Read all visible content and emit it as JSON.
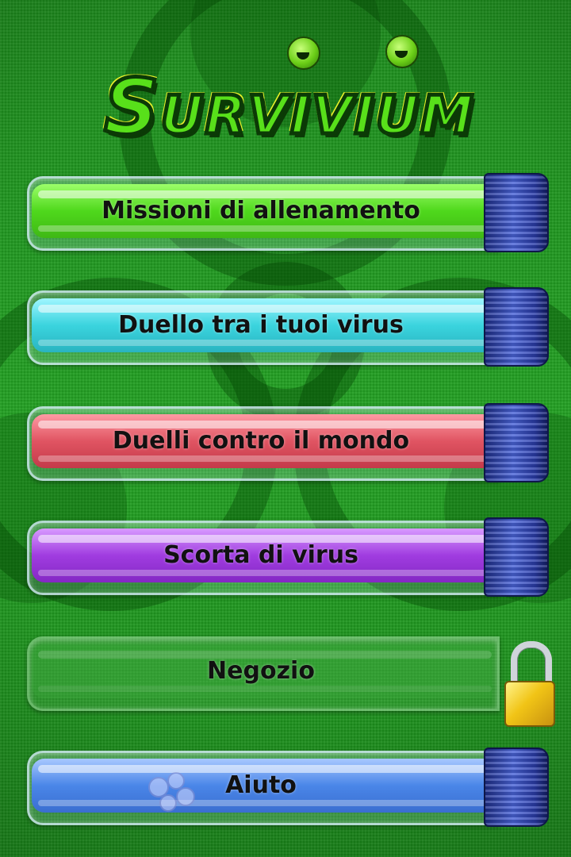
{
  "game": {
    "title": "Survivium"
  },
  "menu": {
    "items": [
      {
        "id": "training",
        "label": "Missioni di allenamento",
        "color": "#5be82a",
        "locked": false
      },
      {
        "id": "duel-own",
        "label": "Duello tra i tuoi virus",
        "color": "#40d8e0",
        "locked": false
      },
      {
        "id": "duel-world",
        "label": "Duelli contro il mondo",
        "color": "#e05a68",
        "locked": false
      },
      {
        "id": "virus-stock",
        "label": "Scorta di virus",
        "color": "#a43ee0",
        "locked": false
      },
      {
        "id": "shop",
        "label": "Negozio",
        "color": "#3aa83a",
        "locked": true
      },
      {
        "id": "help",
        "label": "Aiuto",
        "color": "#4a86e8",
        "locked": false
      }
    ]
  },
  "icons": {
    "background": "biohazard-icon",
    "lock": "padlock-icon",
    "microbe": "microbe-icon"
  },
  "colors": {
    "background": "#1f8f1f",
    "logo_fill": "#58e01a",
    "cap": "#3a50c8"
  }
}
